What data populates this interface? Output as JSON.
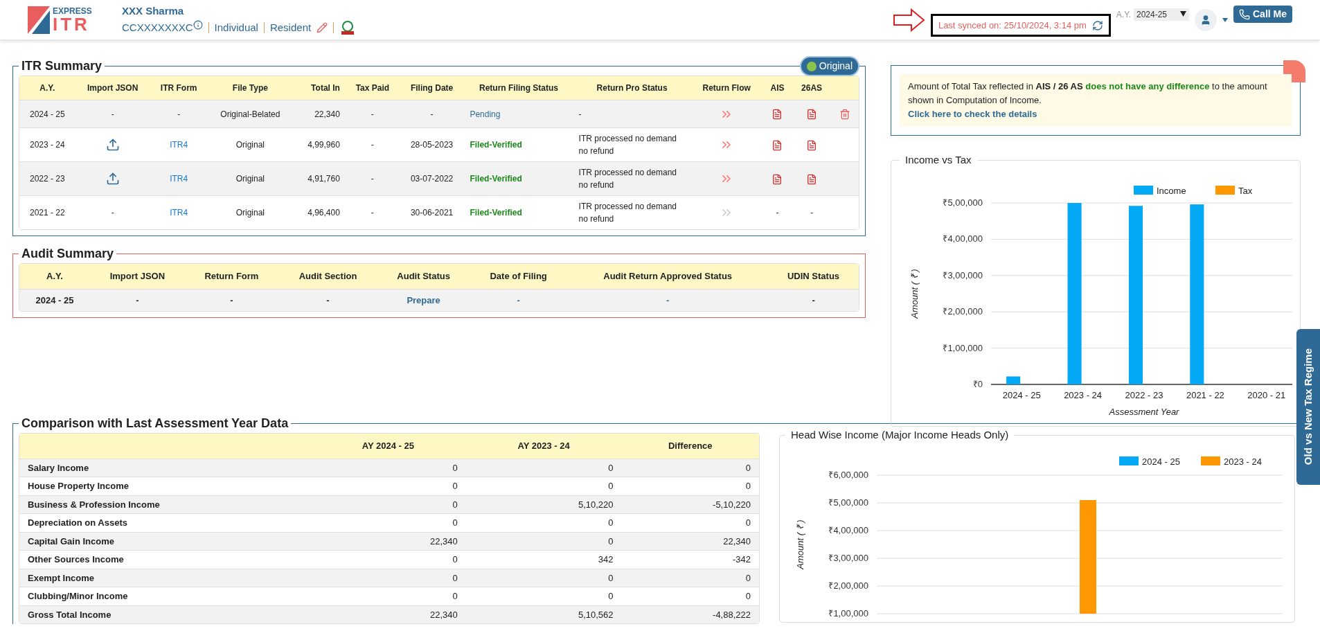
{
  "header": {
    "brand_top": "EXPRESS",
    "brand_main": "ITR",
    "user_name": "XXX Sharma",
    "pan": "CCXXXXXXXC",
    "status": "Individual",
    "residency": "Resident",
    "ay_label": "A.Y.",
    "ay_value": "2024-25",
    "sync_text": "Last synced on: 25/10/2024, 3:14 pm",
    "call_button": "Call Me"
  },
  "itr_summary": {
    "title": "ITR Summary",
    "badge": "Original",
    "columns": [
      "A.Y.",
      "Import JSON",
      "ITR Form",
      "File Type",
      "Total In",
      "Tax Paid",
      "Filing Date",
      "Return Filing Status",
      "Return Pro Status",
      "Return Flow",
      "AIS",
      "26AS"
    ],
    "rows": [
      {
        "ay": "2024 - 25",
        "import_json": {
          "kind": "text",
          "text": "-"
        },
        "itr_form": "-",
        "form_link": false,
        "file_type": "Original-Belated",
        "total_in": "22,340",
        "tax_paid": "-",
        "filing_date": "-",
        "status": "Pending",
        "verified": false,
        "pro_status": "-",
        "flow_active": true,
        "ais": {
          "kind": "pdf"
        },
        "as26": {
          "kind": "pdf"
        },
        "deletable": true
      },
      {
        "ay": "2023 - 24",
        "import_json": {
          "kind": "upload"
        },
        "itr_form": "ITR4",
        "form_link": true,
        "file_type": "Original",
        "total_in": "4,99,960",
        "tax_paid": "-",
        "filing_date": "28-05-2023",
        "status": "Filed-Verified",
        "verified": true,
        "pro_status": "ITR processed no demand no refund",
        "flow_active": true,
        "ais": {
          "kind": "pdf"
        },
        "as26": {
          "kind": "pdf"
        },
        "deletable": false
      },
      {
        "ay": "2022 - 23",
        "import_json": {
          "kind": "upload"
        },
        "itr_form": "ITR4",
        "form_link": true,
        "file_type": "Original",
        "total_in": "4,91,760",
        "tax_paid": "-",
        "filing_date": "03-07-2022",
        "status": "Filed-Verified",
        "verified": true,
        "pro_status": "ITR processed no demand no refund",
        "flow_active": true,
        "ais": {
          "kind": "pdf"
        },
        "as26": {
          "kind": "pdf"
        },
        "deletable": false
      },
      {
        "ay": "2021 - 22",
        "import_json": {
          "kind": "text",
          "text": "-"
        },
        "itr_form": "ITR4",
        "form_link": true,
        "file_type": "Original",
        "total_in": "4,96,400",
        "tax_paid": "-",
        "filing_date": "30-06-2021",
        "status": "Filed-Verified",
        "verified": true,
        "pro_status": "ITR processed no demand no refund",
        "flow_active": false,
        "ais": {
          "kind": "text",
          "text": "-"
        },
        "as26": {
          "kind": "text",
          "text": "-"
        },
        "deletable": false
      }
    ]
  },
  "audit_summary": {
    "title": "Audit Summary",
    "columns": [
      "A.Y.",
      "Import JSON",
      "Return Form",
      "Audit Section",
      "Audit Status",
      "Date of Filing",
      "Audit Return Approved Status",
      "UDIN Status"
    ],
    "rows": [
      {
        "cells": [
          {
            "text": "2024 - 25",
            "kind": "plain"
          },
          {
            "text": "-",
            "kind": "plain"
          },
          {
            "text": "-",
            "kind": "plain"
          },
          {
            "text": "-",
            "kind": "plain"
          },
          {
            "text": "Prepare",
            "kind": "link"
          },
          {
            "text": "-",
            "kind": "link"
          },
          {
            "text": "-",
            "kind": "link"
          },
          {
            "text": "-",
            "kind": "plain"
          }
        ]
      }
    ]
  },
  "ais_notice": {
    "text": "Amount of Total Tax reflected in **AIS / 26 AS**",
    "highlight": "does not have any difference",
    "rest": "to the amount shown in Computation of Income.",
    "link": "Click here to check the details"
  },
  "income_vs_tax": {
    "title": "Income vs Tax",
    "chart_data": {
      "type": "bar",
      "grid": true,
      "xlabel": "Assessment Year",
      "ylabel": "Amount ( ₹ )",
      "categories": [
        "2024 - 25",
        "2023 - 24",
        "2022 - 23",
        "2021 - 22",
        "2020 - 21"
      ],
      "series": [
        {
          "name": "Income",
          "color": "#03a9f4",
          "values": [
            22000,
            500000,
            492000,
            496000,
            0
          ]
        },
        {
          "name": "Tax",
          "color": "#ff9800",
          "values": [
            0,
            0,
            0,
            0,
            0
          ]
        }
      ],
      "ylim": [
        0,
        500000
      ],
      "yticks": [
        {
          "value": 0,
          "label": "₹0"
        },
        {
          "value": 100000,
          "label": "₹1,00,000"
        },
        {
          "value": 200000,
          "label": "₹2,00,000"
        },
        {
          "value": 300000,
          "label": "₹3,00,000"
        },
        {
          "value": 400000,
          "label": "₹4,00,000"
        },
        {
          "value": 500000,
          "label": "₹5,00,000"
        }
      ]
    }
  },
  "comparison": {
    "title": "Comparison with Last Assessment Year Data",
    "columns": [
      "AY 2024 - 25",
      "AY 2023 - 24",
      "Difference"
    ],
    "rows": [
      {
        "label": "Salary Income",
        "values": [
          "0",
          "0",
          "0"
        ]
      },
      {
        "label": "House Property Income",
        "values": [
          "0",
          "0",
          "0"
        ]
      },
      {
        "label": "Business & Profession Income",
        "values": [
          "0",
          "5,10,220",
          "-5,10,220"
        ]
      },
      {
        "label": "Depreciation on Assets",
        "values": [
          "0",
          "0",
          "0"
        ]
      },
      {
        "label": "Capital Gain Income",
        "values": [
          "22,340",
          "0",
          "22,340"
        ]
      },
      {
        "label": "Other Sources Income",
        "values": [
          "0",
          "342",
          "-342"
        ]
      },
      {
        "label": "Exempt Income",
        "values": [
          "0",
          "0",
          "0"
        ]
      },
      {
        "label": "Clubbing/Minor Income",
        "values": [
          "0",
          "0",
          "0"
        ]
      },
      {
        "label": "Gross Total Income",
        "values": [
          "22,340",
          "5,10,562",
          "-4,88,222"
        ]
      }
    ]
  },
  "head_wise": {
    "title": "Head Wise Income (Major Income Heads Only)",
    "chart_data": {
      "type": "bar",
      "grid": true,
      "ylabel": "Amount ( ₹ )",
      "ylim": [
        100000,
        600000
      ],
      "series": [
        {
          "name": "2024 - 25",
          "color": "#03a9f4",
          "values": [
            null,
            null,
            null,
            null,
            null
          ]
        },
        {
          "name": "2023 - 24",
          "color": "#ff9800",
          "values": [
            null,
            null,
            510000,
            null,
            null
          ]
        }
      ],
      "yticks": [
        {
          "value": 100000,
          "label": "₹1,00,000"
        },
        {
          "value": 200000,
          "label": "₹2,00,000"
        },
        {
          "value": 300000,
          "label": "₹3,00,000"
        },
        {
          "value": 400000,
          "label": "₹4,00,000"
        },
        {
          "value": 500000,
          "label": "₹5,00,000"
        },
        {
          "value": 600000,
          "label": "₹6,00,000"
        }
      ]
    }
  },
  "side_tab": "Old vs New Tax Regime"
}
